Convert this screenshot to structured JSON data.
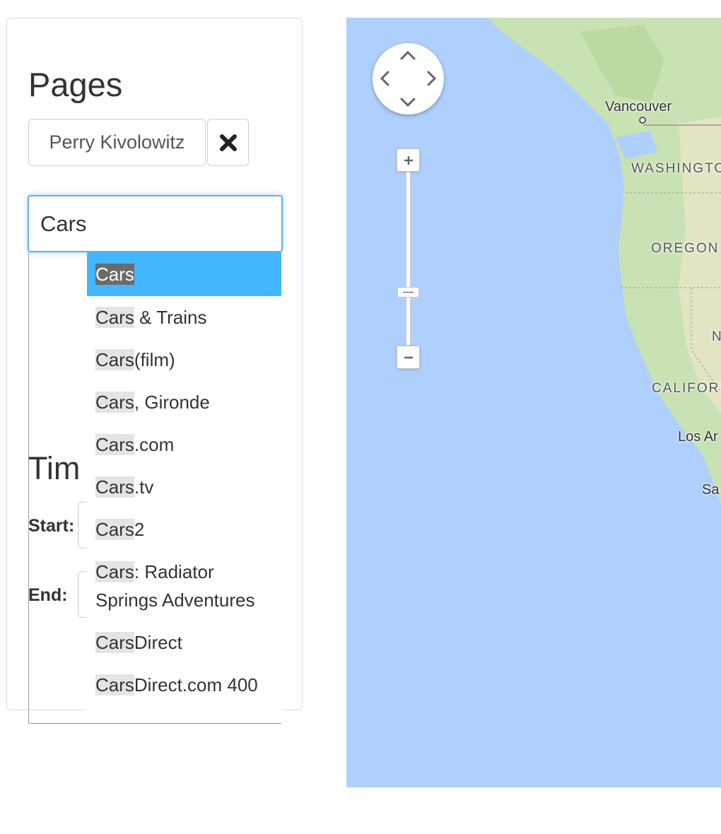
{
  "pages_section": {
    "title": "Pages",
    "selected_tag": "Perry Kivolowitz",
    "remove_icon": "close-x-icon"
  },
  "search": {
    "value": "Cars"
  },
  "autocomplete": {
    "items": [
      {
        "match": "Cars",
        "rest": "",
        "active": true
      },
      {
        "match": "Cars",
        "rest": " & Trains"
      },
      {
        "match": "Cars",
        "rest": "(film)"
      },
      {
        "match": "Cars",
        "rest": ", Gironde"
      },
      {
        "match": "Cars",
        "rest": ".com"
      },
      {
        "match": "Cars",
        "rest": ".tv"
      },
      {
        "match": "Cars",
        "rest": "2"
      },
      {
        "match": "Cars",
        "rest": ": Radiator Springs Adventures"
      },
      {
        "match": "Cars",
        "rest": "Direct"
      },
      {
        "match": "Cars",
        "rest": "Direct.com 400"
      }
    ],
    "active_color": "#44b6ff"
  },
  "time_section": {
    "title": "Tim",
    "start_label": "Start:",
    "end_label": "End:"
  },
  "map": {
    "zoom_in_label": "+",
    "zoom_out_label": "−",
    "labels": {
      "vancouver": "Vancouver",
      "washington": "WASHINGTO",
      "oregon": "OREGON",
      "nevada": "N",
      "california": "CALIFORI",
      "los_angeles": "Los Ar",
      "san_diego": "Sa"
    },
    "water_color": "#afd0fd",
    "land_color": "#c9e2b3"
  }
}
